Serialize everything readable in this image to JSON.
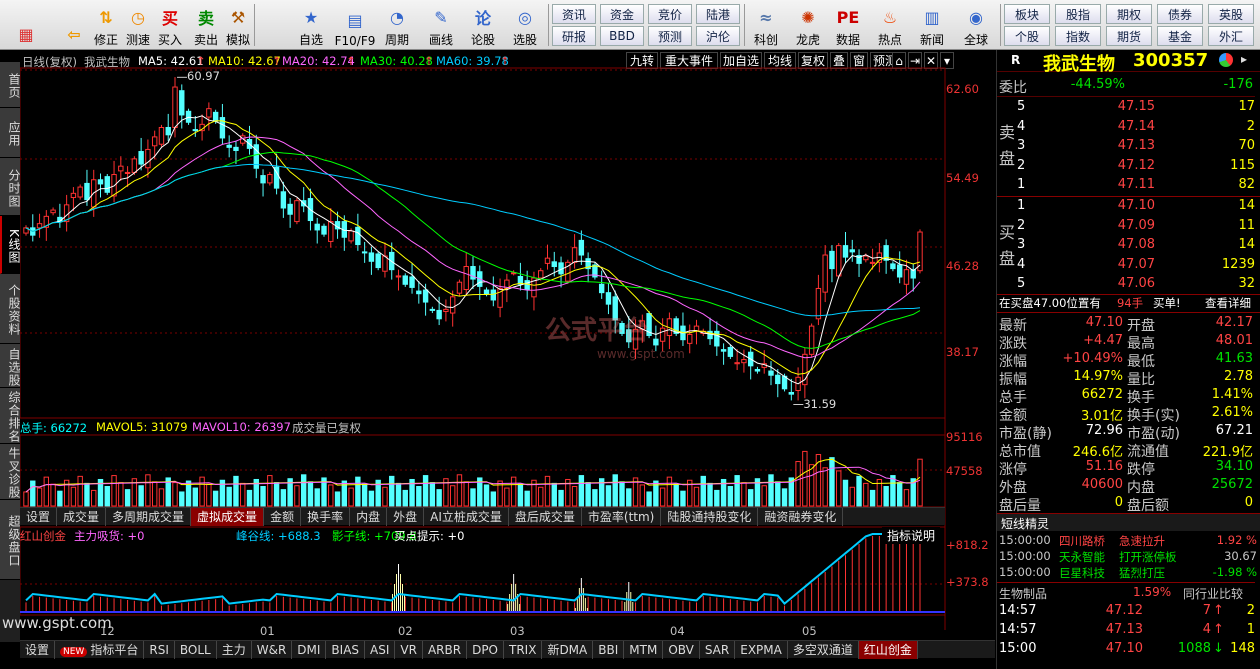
{
  "toolbar": {
    "left": [
      {
        "label": "",
        "icon": "windows-icon"
      },
      {
        "label": "",
        "icon": "back-arrow-icon"
      },
      {
        "label": "修正",
        "icon": "revise-icon"
      },
      {
        "label": "测速",
        "icon": "clock-icon"
      },
      {
        "label": "买入",
        "icon": "buy-icon"
      },
      {
        "label": "卖出",
        "icon": "sell-icon"
      },
      {
        "label": "模拟",
        "icon": "gavel-icon"
      }
    ],
    "mid": [
      {
        "label": "自选",
        "icon": "star-icon"
      },
      {
        "label": "F10/F9",
        "icon": "f10-icon"
      },
      {
        "label": "周期",
        "icon": "period-icon"
      },
      {
        "label": "画线",
        "icon": "pencil-icon"
      },
      {
        "label": "论股",
        "icon": "discuss-icon"
      },
      {
        "label": "选股",
        "icon": "select-icon"
      }
    ],
    "grid1": [
      [
        "资讯",
        "研报"
      ],
      [
        "资金",
        "BBD"
      ],
      [
        "竞价",
        "预测"
      ],
      [
        "陆港",
        "沪伦"
      ]
    ],
    "right": [
      {
        "label": "科创",
        "icon": "kc-icon"
      },
      {
        "label": "龙虎",
        "icon": "dragon-icon"
      },
      {
        "label": "数据",
        "icon": "pe-icon"
      },
      {
        "label": "热点",
        "icon": "hot-icon"
      },
      {
        "label": "新闻",
        "icon": "news-icon"
      },
      {
        "label": "全球",
        "icon": "globe-icon"
      }
    ],
    "grid2": [
      [
        "板块",
        "个股"
      ],
      [
        "股指",
        "指数"
      ],
      [
        "期权",
        "期货"
      ],
      [
        "债券",
        "基金"
      ],
      [
        "英股",
        "外汇"
      ]
    ]
  },
  "left_tabs": [
    "首页",
    "应用",
    "分时图",
    "K线图",
    "个股资料",
    "自选股",
    "综合排名",
    "牛叉诊股",
    "超级盘口"
  ],
  "chart": {
    "title": "日线(复权)",
    "stock": "我武生物",
    "ma": [
      {
        "label": "MA5: 42.61",
        "color": "#ffffff"
      },
      {
        "label": "MA10: 42.67",
        "color": "#ffff00"
      },
      {
        "label": "MA20: 42.74",
        "color": "#ff66ff"
      },
      {
        "label": "MA30: 40.28",
        "color": "#00ff00"
      },
      {
        "label": "MA60: 39.78",
        "color": "#00ccff"
      }
    ],
    "buttons": [
      "九转",
      "重大事件",
      "加自选",
      "均线",
      "复权",
      "叠",
      "窗",
      "预测"
    ],
    "yticks": [
      "62.60",
      "54.49",
      "46.28",
      "38.17"
    ],
    "high_label": "60.97",
    "low_label": "31.59",
    "vol_labels": [
      {
        "t": "总手: 66272",
        "c": "#00ffff"
      },
      {
        "t": "MAVOL5: 31079",
        "c": "#ffff00"
      },
      {
        "t": "MAVOL10: 26397",
        "c": "#ff66ff"
      },
      {
        "t": "成交量已复权",
        "c": "#c0c0c0"
      }
    ],
    "vol_ticks": [
      "95116",
      "47558"
    ],
    "tabs1": [
      "设置",
      "成交量",
      "多周期成交量",
      "虚拟成交量",
      "金额",
      "换手率",
      "内盘",
      "外盘",
      "AI立桩成交量",
      "盘后成交量",
      "市盈率(ttm)",
      "陆股通持股变化",
      "融资融券变化"
    ],
    "ind_labels": [
      {
        "t": "红山创金",
        "c": "#ff4444"
      },
      {
        "t": "主力吸货: +0",
        "c": "#ff66ff"
      },
      {
        "t": "峰谷线: +688.3",
        "c": "#00ccff"
      },
      {
        "t": "影子线: +709.8",
        "c": "#00ff00"
      },
      {
        "t": "买点提示: +0",
        "c": "#ffffff"
      }
    ],
    "ind_help": "指标说明",
    "ind_ticks": [
      "+818.2",
      "+373.8"
    ],
    "dates": [
      "12",
      "01",
      "02",
      "03",
      "04",
      "05"
    ],
    "tabs2": [
      "设置",
      "指标平台",
      "RSI",
      "BOLL",
      "主力",
      "W&R",
      "DMI",
      "BIAS",
      "ASI",
      "VR",
      "ARBR",
      "DPO",
      "TRIX",
      "新DMA",
      "BBI",
      "MTM",
      "OBV",
      "SAR",
      "EXPMA",
      "多空双通道",
      "红山创金"
    ],
    "new_badge": "NEW",
    "watermark": "公式平台",
    "watermark_url": "www.gspt.com",
    "site": "www.gspt.com",
    "candles": [
      47.5,
      46.8,
      47.9,
      48.6,
      49.2,
      48.1,
      49.7,
      50.8,
      51.4,
      50.2,
      52.1,
      51.7,
      50.9,
      52.6,
      53.4,
      52.8,
      54.1,
      53.6,
      55.0,
      56.2,
      57.1,
      56.4,
      60.97,
      58.3,
      57.6,
      56.8,
      57.4,
      58.9,
      57.7,
      56.1,
      55.2,
      54.9,
      56.3,
      55.1,
      53.2,
      51.8,
      52.6,
      51.3,
      49.4,
      48.8,
      50.1,
      49.6,
      48.2,
      47.3,
      46.9,
      48.1,
      47.4,
      46.6,
      47.2,
      45.9,
      45.1,
      44.3,
      43.7,
      44.8,
      43.5,
      42.9,
      42.1,
      41.8,
      41.2,
      40.4,
      39.6,
      38.8,
      39.7,
      40.9,
      42.3,
      43.8,
      42.6,
      41.9,
      41.2,
      40.6,
      41.7,
      42.5,
      43.2,
      42.1,
      41.6,
      42.7,
      43.4,
      44.6,
      43.8,
      43.1,
      44.2,
      45.6,
      44.9,
      43.6,
      42.8,
      41.3,
      40.2,
      38.7,
      37.4,
      36.6,
      37.8,
      38.6,
      37.2,
      36.3,
      37.9,
      38.8,
      37.4,
      36.8,
      37.3,
      38.1,
      37.6,
      36.9,
      36.2,
      35.7,
      35.2,
      34.6,
      34.9,
      34.3,
      33.8,
      34.5,
      33.4,
      32.6,
      32.1,
      31.59,
      33.2,
      35.4,
      38.1,
      41.7,
      44.9,
      43.6,
      45.8,
      44.7,
      45.2,
      44.1,
      44.8,
      44.2,
      45.1,
      44.4,
      43.6,
      42.8,
      43.5,
      42.7,
      47.1
    ]
  },
  "quote": {
    "name": "我武生物",
    "code": "300357",
    "marker": "R",
    "weibi": {
      "label": "委比",
      "pct": "-44.59%",
      "diff": "-176"
    },
    "sell_label": [
      "卖",
      "盘"
    ],
    "buy_label": [
      "买",
      "盘"
    ],
    "sells": [
      {
        "lv": "5",
        "p": "47.15",
        "v": "17"
      },
      {
        "lv": "4",
        "p": "47.14",
        "v": "2"
      },
      {
        "lv": "3",
        "p": "47.13",
        "v": "70"
      },
      {
        "lv": "2",
        "p": "47.12",
        "v": "115"
      },
      {
        "lv": "1",
        "p": "47.11",
        "v": "82"
      }
    ],
    "buys": [
      {
        "lv": "1",
        "p": "47.10",
        "v": "14"
      },
      {
        "lv": "2",
        "p": "47.09",
        "v": "11"
      },
      {
        "lv": "3",
        "p": "47.08",
        "v": "14"
      },
      {
        "lv": "4",
        "p": "47.07",
        "v": "1239"
      },
      {
        "lv": "5",
        "p": "47.06",
        "v": "32"
      }
    ],
    "inbuy": {
      "text": "在买盘47.00位置有",
      "num": "94手",
      "buy1": "买单!",
      "detail": "查看详细"
    },
    "stats": [
      {
        "k1": "最新",
        "v1": "47.10",
        "c1": "red",
        "k2": "开盘",
        "v2": "42.17",
        "c2": "red"
      },
      {
        "k1": "涨跌",
        "v1": "+4.47",
        "c1": "red",
        "k2": "最高",
        "v2": "48.01",
        "c2": "red"
      },
      {
        "k1": "涨幅",
        "v1": "+10.49%",
        "c1": "red",
        "k2": "最低",
        "v2": "41.63",
        "c2": "grn"
      },
      {
        "k1": "振幅",
        "v1": "14.97%",
        "c1": "yel",
        "k2": "量比",
        "v2": "2.78",
        "c2": "yel"
      },
      {
        "k1": "总手",
        "v1": "66272",
        "c1": "yel",
        "k2": "换手",
        "v2": "1.41%",
        "c2": "yel"
      },
      {
        "k1": "金额",
        "v1": "3.01亿",
        "c1": "yel",
        "k2": "换手(实)",
        "v2": "2.61%",
        "c2": "yel"
      },
      {
        "k1": "市盈(静)",
        "v1": "72.96",
        "c1": "wht",
        "k2": "市盈(动)",
        "v2": "67.21",
        "c2": "wht"
      },
      {
        "k1": "总市值",
        "v1": "246.6亿",
        "c1": "yel",
        "k2": "流通值",
        "v2": "221.9亿",
        "c2": "yel"
      },
      {
        "k1": "涨停",
        "v1": "51.16",
        "c1": "red",
        "k2": "跌停",
        "v2": "34.10",
        "c2": "grn"
      },
      {
        "k1": "外盘",
        "v1": "40600",
        "c1": "red",
        "k2": "内盘",
        "v2": "25672",
        "c2": "grn"
      },
      {
        "k1": "盘后量",
        "v1": "0",
        "c1": "yel",
        "k2": "盘后额",
        "v2": "0",
        "c2": "yel"
      }
    ],
    "elf_title": "短线精灵",
    "elf": [
      {
        "t": "15:00:00",
        "n": "四川路桥",
        "e": "急速拉升",
        "v": "1.92 %",
        "ec": "red",
        "vc": "red"
      },
      {
        "t": "15:00:00",
        "n": "天永智能",
        "e": "打开涨停板",
        "v": "30.67",
        "ec": "grn",
        "vc": "gry"
      },
      {
        "t": "15:00:00",
        "n": "巨星科技",
        "e": "猛烈打压",
        "v": "-1.98 %",
        "ec": "grn",
        "vc": "grn"
      }
    ],
    "sector": {
      "name": "生物制品",
      "pct": "1.59%",
      "cmp": "同行业比较"
    },
    "ticks": [
      {
        "t": "14:57",
        "p": "47.12",
        "v": "7",
        "d": "up"
      },
      {
        "t": "14:57",
        "p": "47.13",
        "v": "4",
        "d": "up"
      },
      {
        "t": "15:00",
        "p": "47.10",
        "v": "1088",
        "d": "down"
      }
    ],
    "tick_extra": [
      "2",
      "1",
      "148"
    ]
  }
}
